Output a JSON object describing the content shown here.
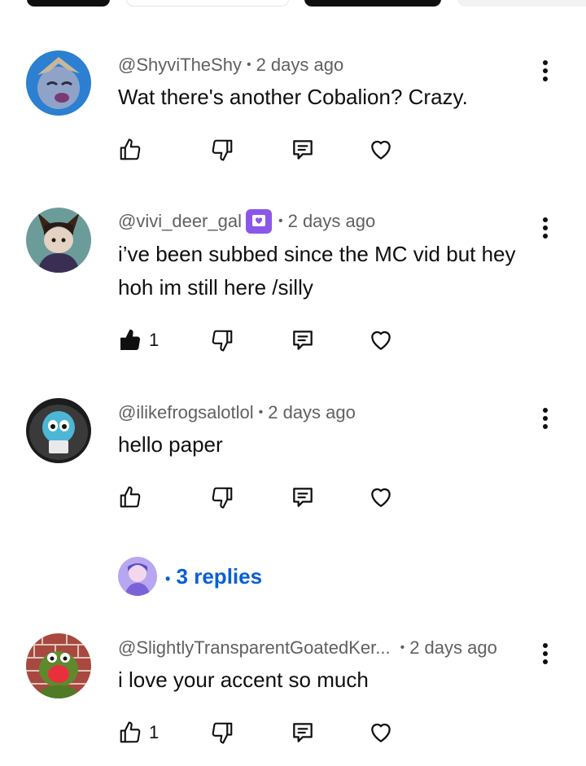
{
  "comments": [
    {
      "handle": "@ShyviTheShy",
      "time": "2 days ago",
      "text": "Wat there's another Cobalion? Crazy.",
      "likes": "",
      "liked": false,
      "badge": false
    },
    {
      "handle": "@vivi_deer_gal",
      "time": "2 days ago",
      "text": "i’ve been subbed since the MC vid but hey hoh im still here /silly",
      "likes": "1",
      "liked": true,
      "badge": true
    },
    {
      "handle": "@ilikefrogsalotlol",
      "time": "2 days ago",
      "text": "hello paper",
      "likes": "",
      "liked": false,
      "badge": false
    },
    {
      "handle": "@SlightlyTransparentGoatedKer...",
      "time": "2 days ago",
      "text": "i love your accent so much",
      "likes": "1",
      "liked": false,
      "badge": false
    }
  ],
  "separator": "•",
  "replies": {
    "label": "3 replies"
  },
  "icons": {
    "like": "thumbs-up-icon",
    "dislike": "thumbs-down-icon",
    "reply": "comment-icon",
    "heart": "heart-icon",
    "more": "more-vert-icon"
  },
  "colors": {
    "link": "#065fd4",
    "member_badge": "#8c57e8",
    "meta": "#606060"
  }
}
